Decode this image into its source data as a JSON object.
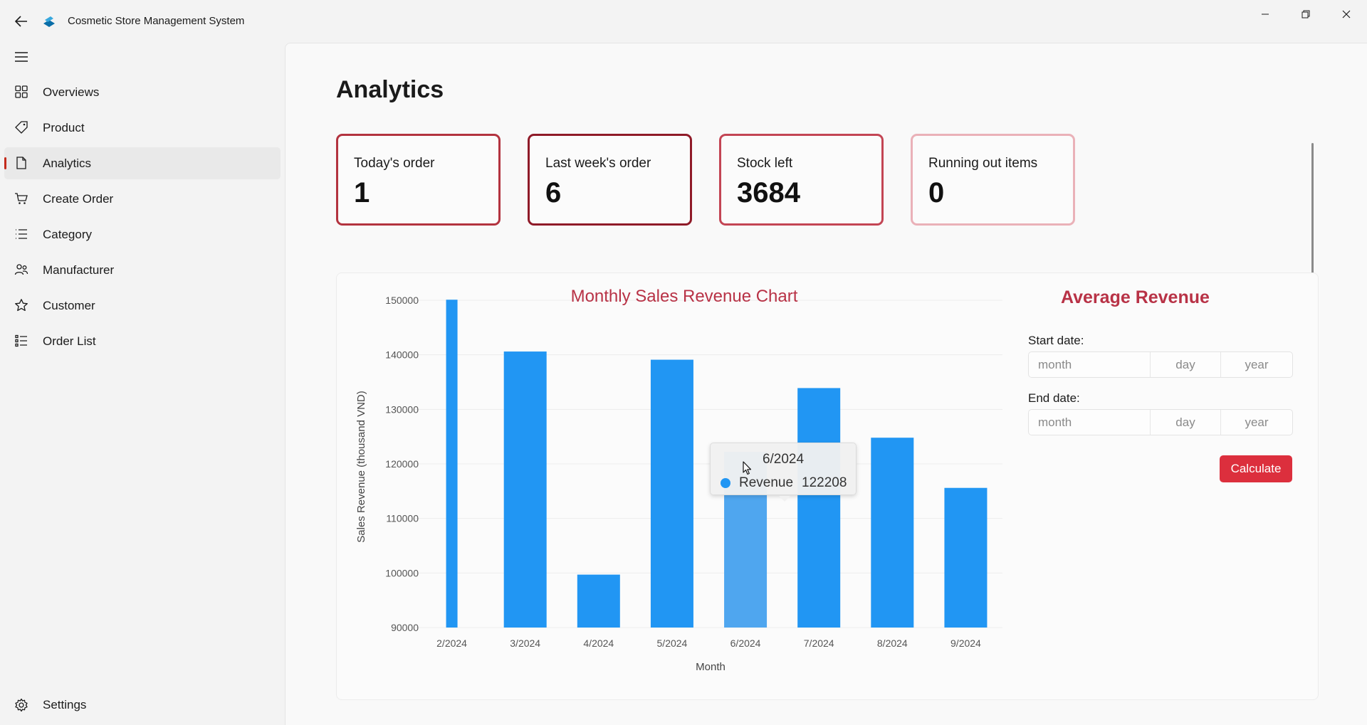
{
  "window": {
    "title": "Cosmetic Store Management System"
  },
  "sidebar": {
    "items": [
      {
        "label": "Overviews",
        "icon": "grid-icon"
      },
      {
        "label": "Product",
        "icon": "tag-icon"
      },
      {
        "label": "Analytics",
        "icon": "document-icon",
        "active": true
      },
      {
        "label": "Create Order",
        "icon": "cart-icon"
      },
      {
        "label": "Category",
        "icon": "list-icon"
      },
      {
        "label": "Manufacturer",
        "icon": "people-icon"
      },
      {
        "label": "Customer",
        "icon": "star-icon"
      },
      {
        "label": "Order List",
        "icon": "bullet-list-icon"
      }
    ],
    "settings_label": "Settings"
  },
  "page": {
    "title": "Analytics"
  },
  "stats": [
    {
      "label": "Today's order",
      "value": "1"
    },
    {
      "label": "Last week's order",
      "value": "6"
    },
    {
      "label": "Stock left",
      "value": "3684"
    },
    {
      "label": "Running out items",
      "value": "0"
    }
  ],
  "chart_data": {
    "type": "bar",
    "title": "Monthly Sales Revenue Chart",
    "xlabel": "Month",
    "ylabel": "Sales Revenue (thousand VND)",
    "ylim": [
      90000,
      150000
    ],
    "yticks": [
      "150000",
      "140000",
      "130000",
      "120000",
      "110000",
      "100000",
      "90000"
    ],
    "categories": [
      "2/2024",
      "3/2024",
      "4/2024",
      "5/2024",
      "6/2024",
      "7/2024",
      "8/2024",
      "9/2024"
    ],
    "series": [
      {
        "name": "Revenue",
        "values": [
          150500,
          140600,
          99700,
          139100,
          122208,
          133900,
          124800,
          115600
        ]
      }
    ],
    "highlighted_index": 4,
    "grid": true,
    "bar_color": "#2196f3",
    "highlight_color": "#4fa6ef"
  },
  "tooltip": {
    "title": "6/2024",
    "series": "Revenue",
    "value": "122208"
  },
  "average_revenue": {
    "title": "Average Revenue",
    "start_label": "Start date:",
    "end_label": "End date:",
    "month_placeholder": "month",
    "day_placeholder": "day",
    "year_placeholder": "year",
    "calculate_label": "Calculate"
  },
  "colors": {
    "accent": "#c42b1c",
    "brand_red": "#b83246",
    "button": "#dc2f3d"
  }
}
